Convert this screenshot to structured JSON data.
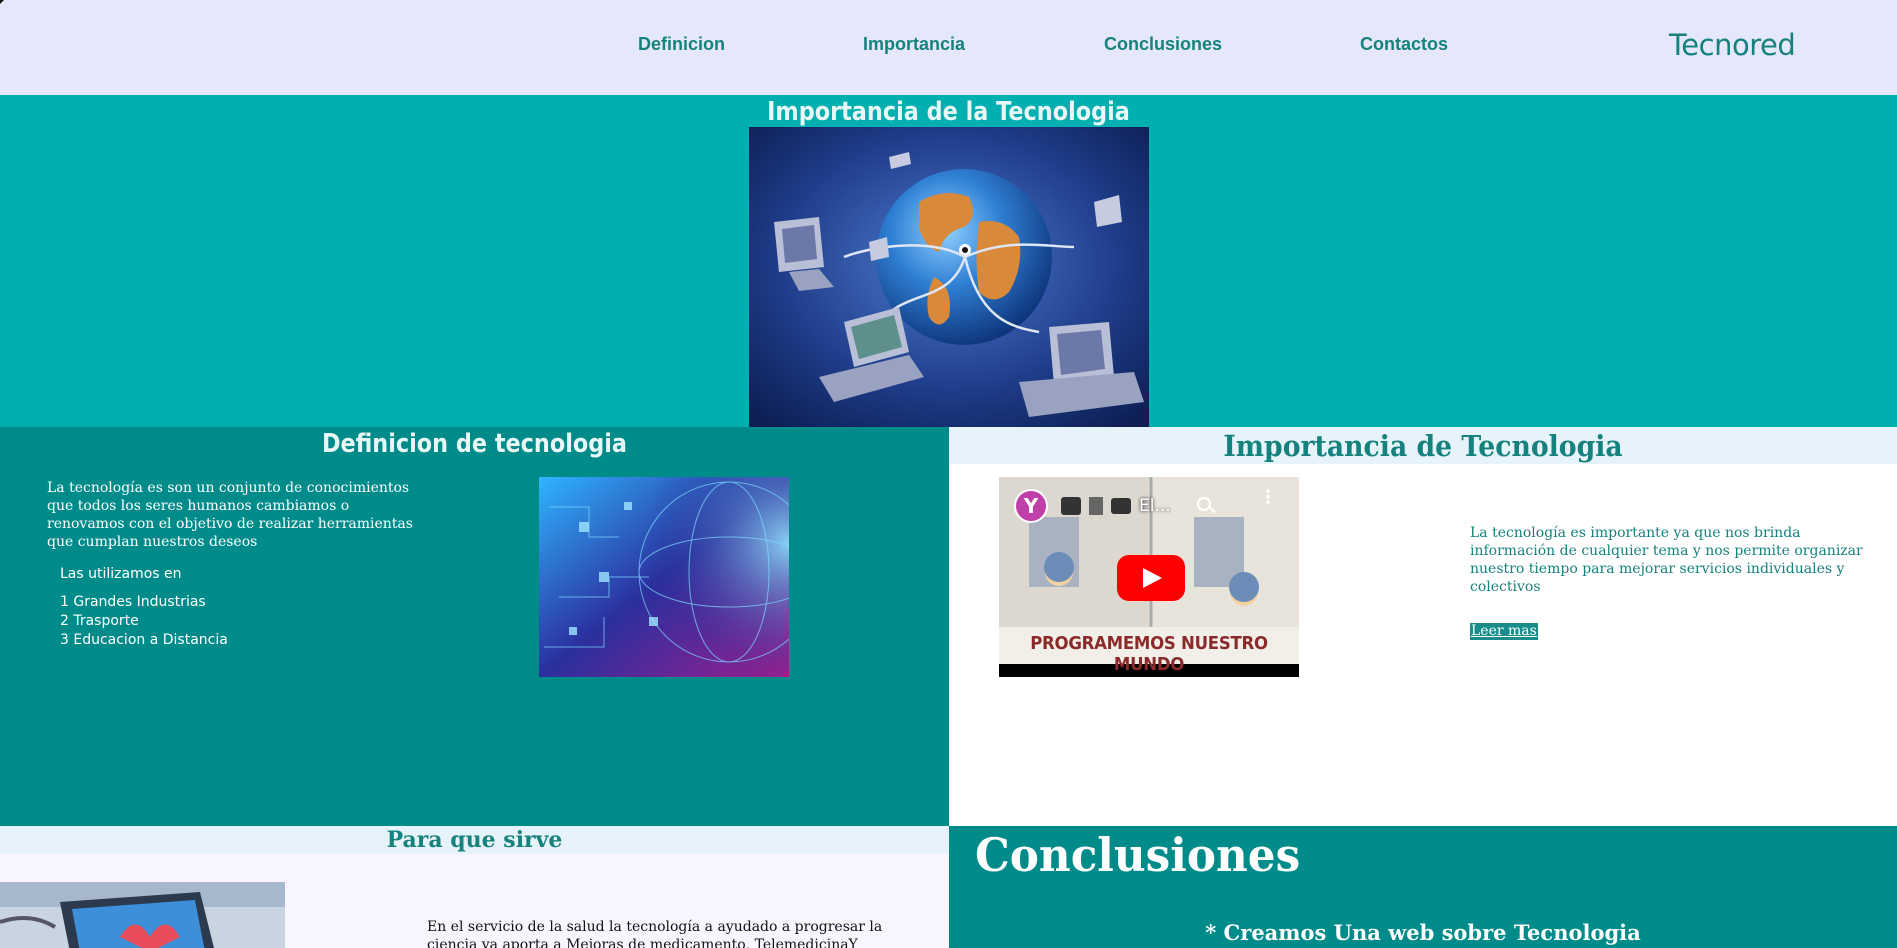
{
  "header": {
    "nav": [
      "Definicion",
      "Importancia",
      "Conclusiones",
      "Contactos"
    ],
    "brand": "Tecnored"
  },
  "hero": {
    "title": "Importancia de la Tecnologia",
    "image_desc": "globe-network-illustration"
  },
  "definition": {
    "title": "Definicion de tecnologia",
    "text": "La tecnología es son un conjunto de conocimientos que todos los seres humanos cambiamos o renovamos con el objetivo de realizar herramientas que cumplan nuestros deseos",
    "uses_intro": "Las utilizamos en",
    "uses": [
      "1 Grandes Industrias",
      "2 Trasporte",
      "3 Educacion a Distancia"
    ]
  },
  "importance": {
    "title": "Importancia de Tecnologia",
    "video": {
      "channel_letter": "Y",
      "title": "El...",
      "banner": "PROGRAMEMOS NUESTRO MUNDO"
    },
    "text": "La tecnología es importante ya que nos brinda información de cualquier tema y nos permite organizar nuestro tiempo para mejorar servicios individuales y colectivos",
    "read_more": "Leer mas"
  },
  "purpose": {
    "title": "Para que sirve",
    "text": "En el servicio de la salud la tecnología a ayudado a progresar la ciencia ya aporta a Mejoras de medicamento, TelemedicinaY dispositivos"
  },
  "conclusions": {
    "title": "Conclusiones",
    "item": "* Creamos Una web sobre Tecnologia"
  },
  "colors": {
    "header_bg": "#e5e8fb",
    "teal_light": "#00afaf",
    "teal_dark": "#008b8b",
    "link": "#15827d"
  }
}
